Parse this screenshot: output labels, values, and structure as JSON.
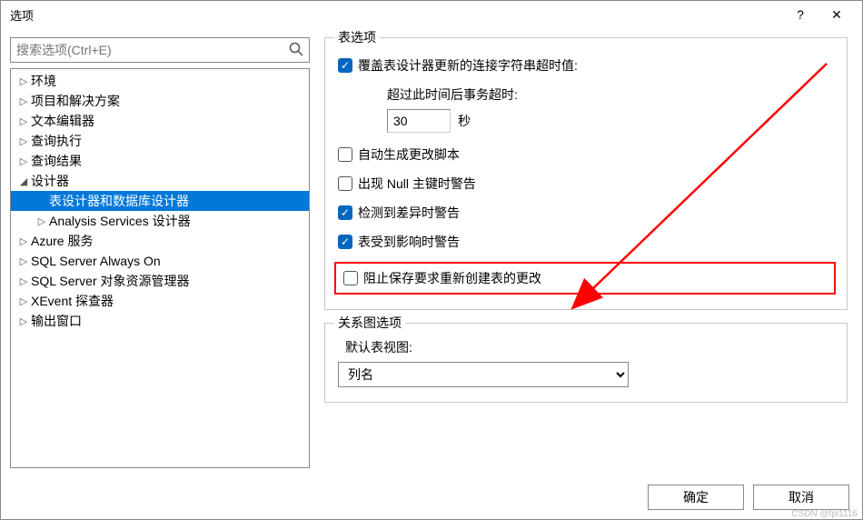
{
  "title": "选项",
  "help_tooltip": "?",
  "close_tooltip": "✕",
  "search": {
    "placeholder": "搜索选项(Ctrl+E)",
    "icon_name": "search-icon"
  },
  "tree": [
    {
      "label": "环境",
      "arrow": "▷",
      "level": 1,
      "selected": false
    },
    {
      "label": "项目和解决方案",
      "arrow": "▷",
      "level": 1,
      "selected": false
    },
    {
      "label": "文本编辑器",
      "arrow": "▷",
      "level": 1,
      "selected": false
    },
    {
      "label": "查询执行",
      "arrow": "▷",
      "level": 1,
      "selected": false
    },
    {
      "label": "查询结果",
      "arrow": "▷",
      "level": 1,
      "selected": false
    },
    {
      "label": "设计器",
      "arrow": "◢",
      "level": 1,
      "selected": false
    },
    {
      "label": "表设计器和数据库设计器",
      "arrow": "",
      "level": 2,
      "selected": true
    },
    {
      "label": "Analysis Services 设计器",
      "arrow": "▷",
      "level": 2,
      "selected": false
    },
    {
      "label": "Azure 服务",
      "arrow": "▷",
      "level": 1,
      "selected": false
    },
    {
      "label": "SQL Server Always On",
      "arrow": "▷",
      "level": 1,
      "selected": false
    },
    {
      "label": "SQL Server 对象资源管理器",
      "arrow": "▷",
      "level": 1,
      "selected": false
    },
    {
      "label": "XEvent 探查器",
      "arrow": "▷",
      "level": 1,
      "selected": false
    },
    {
      "label": "输出窗口",
      "arrow": "▷",
      "level": 1,
      "selected": false
    }
  ],
  "table_options": {
    "group_title": "表选项",
    "override_connstring": {
      "label": "覆盖表设计器更新的连接字符串超时值:",
      "checked": true
    },
    "timeout_label": "超过此时间后事务超时:",
    "timeout_value": "30",
    "timeout_unit": "秒",
    "auto_script": {
      "label": "自动生成更改脚本",
      "checked": false
    },
    "null_warn": {
      "label": "出现 Null 主键时警告",
      "checked": false
    },
    "diff_warn": {
      "label": "检测到差异时警告",
      "checked": true
    },
    "affect_warn": {
      "label": "表受到影响时警告",
      "checked": true
    },
    "prevent_save": {
      "label": "阻止保存要求重新创建表的更改",
      "checked": false
    }
  },
  "diagram_options": {
    "group_title": "关系图选项",
    "default_view_label": "默认表视图:",
    "default_view_value": "列名"
  },
  "buttons": {
    "ok": "确定",
    "cancel": "取消"
  },
  "watermark": "CSDN @fpl1116"
}
